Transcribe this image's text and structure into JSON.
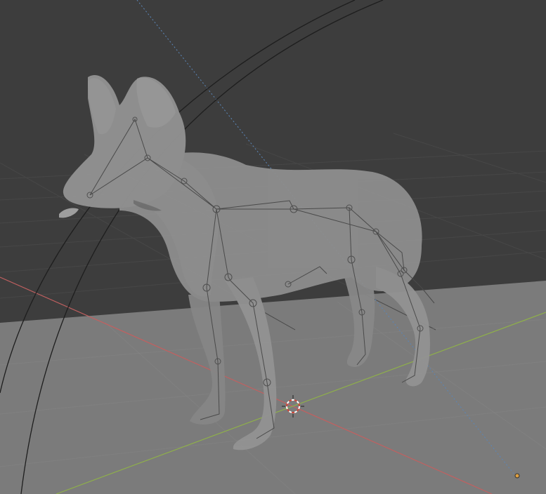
{
  "viewport": {
    "background_color": "#3d3d3d",
    "floor_color": "#7b7b7b",
    "x_axis_color": "#c26060",
    "y_axis_color": "#8fb04a",
    "z_axis_color": "#5b86b8",
    "mesh_color": "#8e8e8e",
    "bone_color": "#4a4a4a",
    "cursor_colors": [
      "#d0483a",
      "#ffffff"
    ],
    "light_color": "#e0a040"
  },
  "scene_objects": [
    {
      "name": "dog-mesh",
      "type": "mesh",
      "display": "x-ray"
    },
    {
      "name": "armature",
      "type": "armature",
      "display": "octahedral"
    },
    {
      "name": "3d-cursor",
      "type": "cursor"
    },
    {
      "name": "spot-light",
      "type": "light"
    }
  ]
}
